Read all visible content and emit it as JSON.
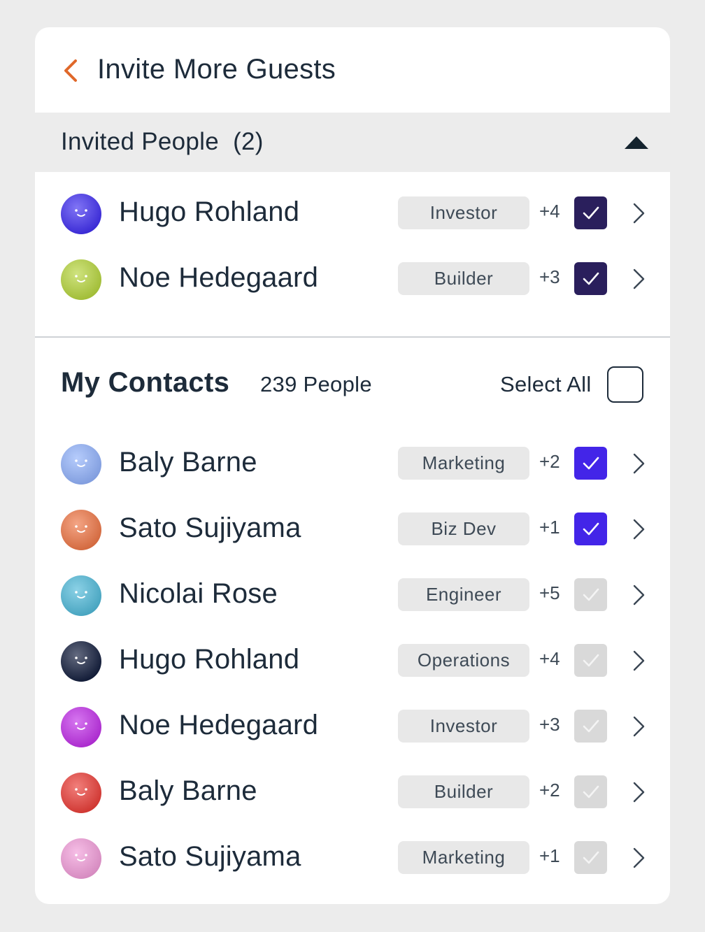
{
  "header": {
    "back_icon": "chevron-left-icon",
    "title": "Invite More Guests",
    "accent_color": "#e0682a"
  },
  "invited": {
    "title": "Invited People  (2)",
    "collapse_icon": "triangle-up-icon",
    "people": [
      {
        "name": "Hugo Rohland",
        "role": "Investor",
        "extra": "+4",
        "checked": true,
        "avatar_color": "#3d2bf0"
      },
      {
        "name": "Noe Hedegaard",
        "role": "Builder",
        "extra": "+3",
        "checked": true,
        "avatar_color": "#b5d43a"
      }
    ]
  },
  "contacts": {
    "title": "My Contacts",
    "count": "239 People",
    "select_all_label": "Select All",
    "select_all_checked": false,
    "people": [
      {
        "name": "Baly Barne",
        "role": "Marketing",
        "extra": "+2",
        "checked": true,
        "avatar_color": "#8fb0fb"
      },
      {
        "name": "Sato Sujiyama",
        "role": "Biz Dev",
        "extra": "+1",
        "checked": true,
        "avatar_color": "#ee7443"
      },
      {
        "name": "Nicolai Rose",
        "role": "Engineer",
        "extra": "+5",
        "checked": false,
        "avatar_color": "#4db8d8"
      },
      {
        "name": "Hugo Rohland",
        "role": "Operations",
        "extra": "+4",
        "checked": false,
        "avatar_color": "#0f1a3a"
      },
      {
        "name": "Noe Hedegaard",
        "role": "Investor",
        "extra": "+3",
        "checked": false,
        "avatar_color": "#c02ce8"
      },
      {
        "name": "Baly Barne",
        "role": "Builder",
        "extra": "+2",
        "checked": false,
        "avatar_color": "#ea3a34"
      },
      {
        "name": "Sato Sujiyama",
        "role": "Marketing",
        "extra": "+1",
        "checked": false,
        "avatar_color": "#f19bd8"
      }
    ]
  },
  "colors": {
    "invited_check": "#2a1f5c",
    "contact_check": "#4325e8",
    "unchecked_check": "#d9d9d9",
    "text": "#1d2b3a"
  }
}
